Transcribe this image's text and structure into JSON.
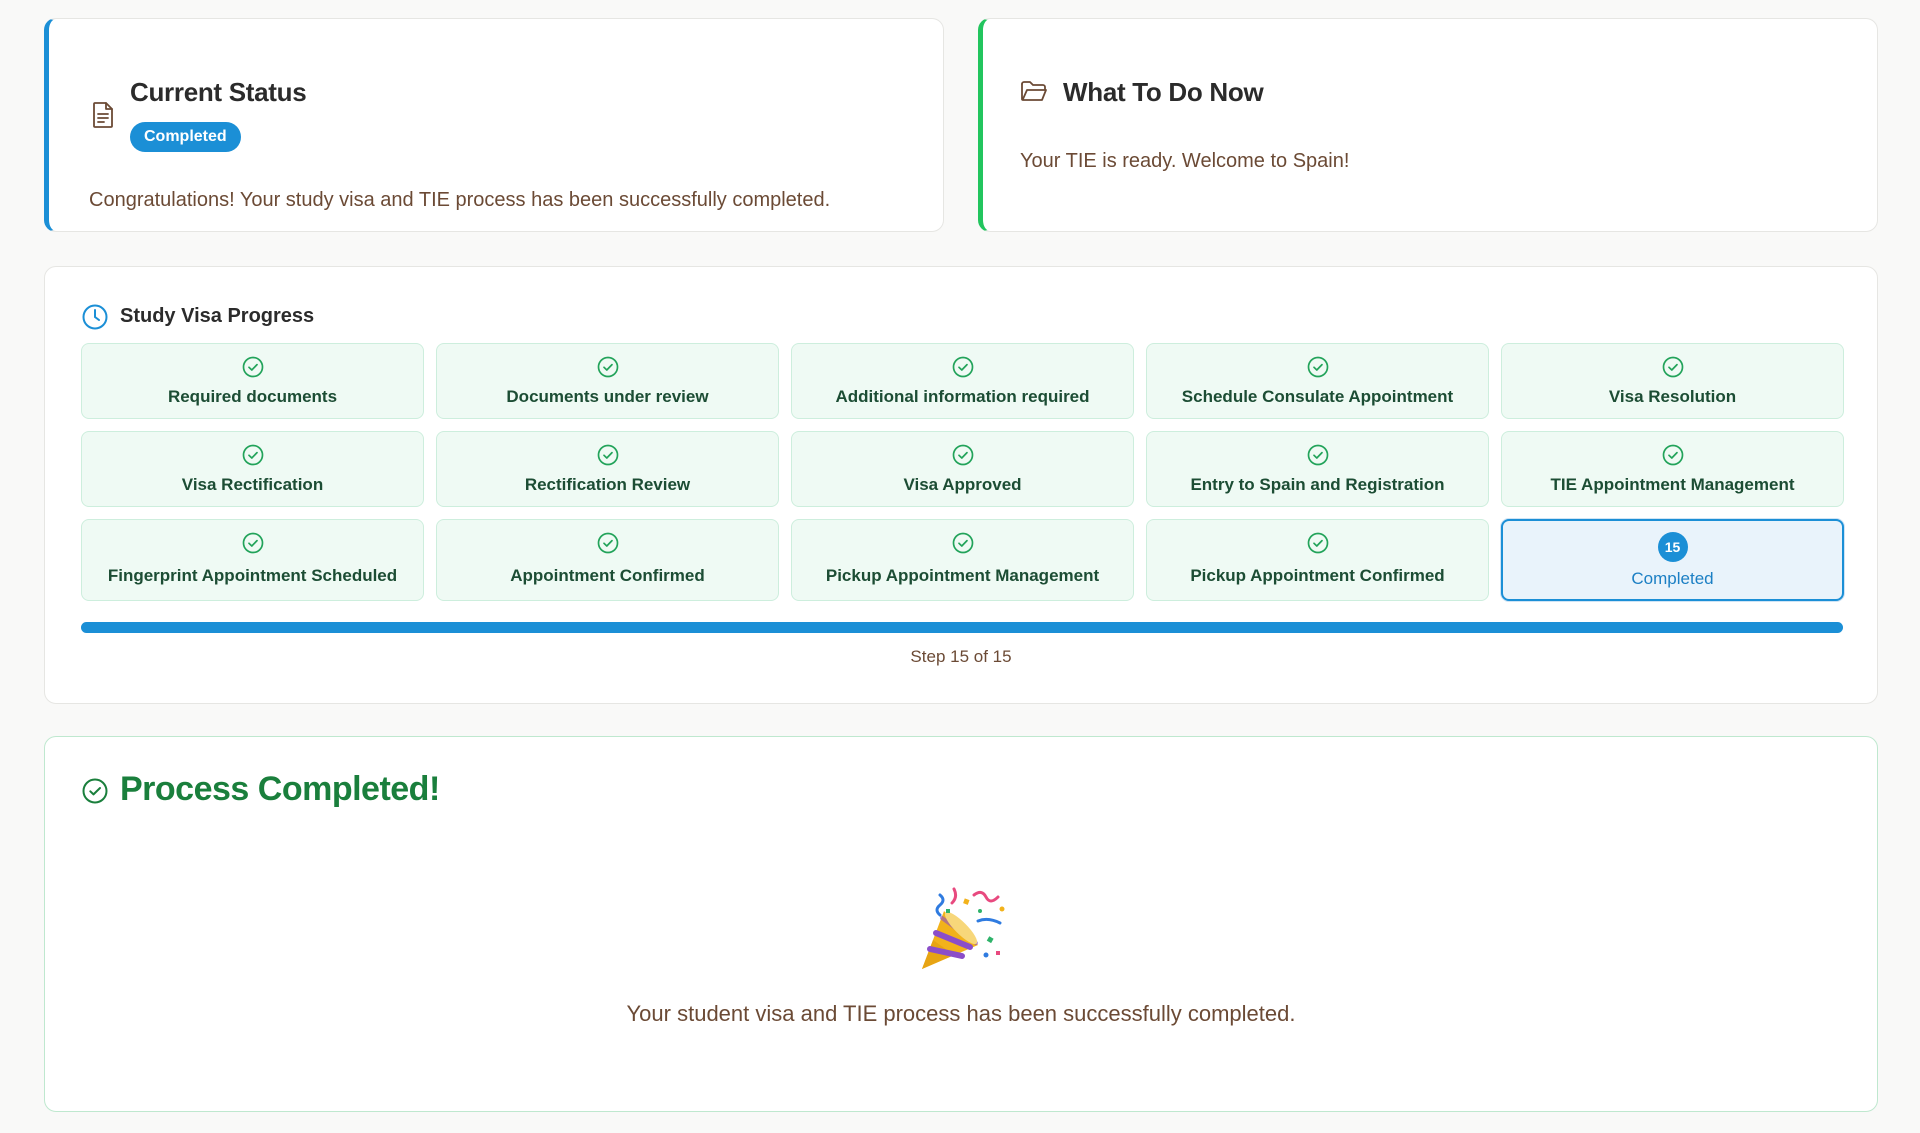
{
  "status": {
    "title": "Current Status",
    "badge": "Completed",
    "message": "Congratulations! Your study visa and TIE process has been successfully completed.",
    "accent_color": "#1b8fd6",
    "icon": "document-icon"
  },
  "todo": {
    "title": "What To Do Now",
    "message": "Your TIE is ready. Welcome to Spain!",
    "accent_color": "#22c55e",
    "icon": "folder-icon"
  },
  "progress": {
    "title": "Study Visa Progress",
    "icon": "clock-icon",
    "steps": [
      {
        "label": "Required documents",
        "state": "done"
      },
      {
        "label": "Documents under review",
        "state": "done"
      },
      {
        "label": "Additional information required",
        "state": "done"
      },
      {
        "label": "Schedule Consulate Appointment",
        "state": "done"
      },
      {
        "label": "Visa Resolution",
        "state": "done"
      },
      {
        "label": "Visa Rectification",
        "state": "done"
      },
      {
        "label": "Rectification Review",
        "state": "done"
      },
      {
        "label": "Visa Approved",
        "state": "done"
      },
      {
        "label": "Entry to Spain and Registration",
        "state": "done"
      },
      {
        "label": "TIE Appointment Management",
        "state": "done"
      },
      {
        "label": "Fingerprint Appointment Scheduled",
        "state": "done"
      },
      {
        "label": "Appointment Confirmed",
        "state": "done"
      },
      {
        "label": "Pickup Appointment Management",
        "state": "done"
      },
      {
        "label": "Pickup Appointment Confirmed",
        "state": "done"
      },
      {
        "label": "Completed",
        "state": "current",
        "number": "15"
      }
    ],
    "fraction_complete": 1.0,
    "step_text": "Step 15 of 15"
  },
  "complete": {
    "title": "Process Completed!",
    "icon": "check-circle-icon",
    "emoji_icon": "party-popper-icon",
    "message": "Your student visa and TIE process has been successfully completed."
  }
}
